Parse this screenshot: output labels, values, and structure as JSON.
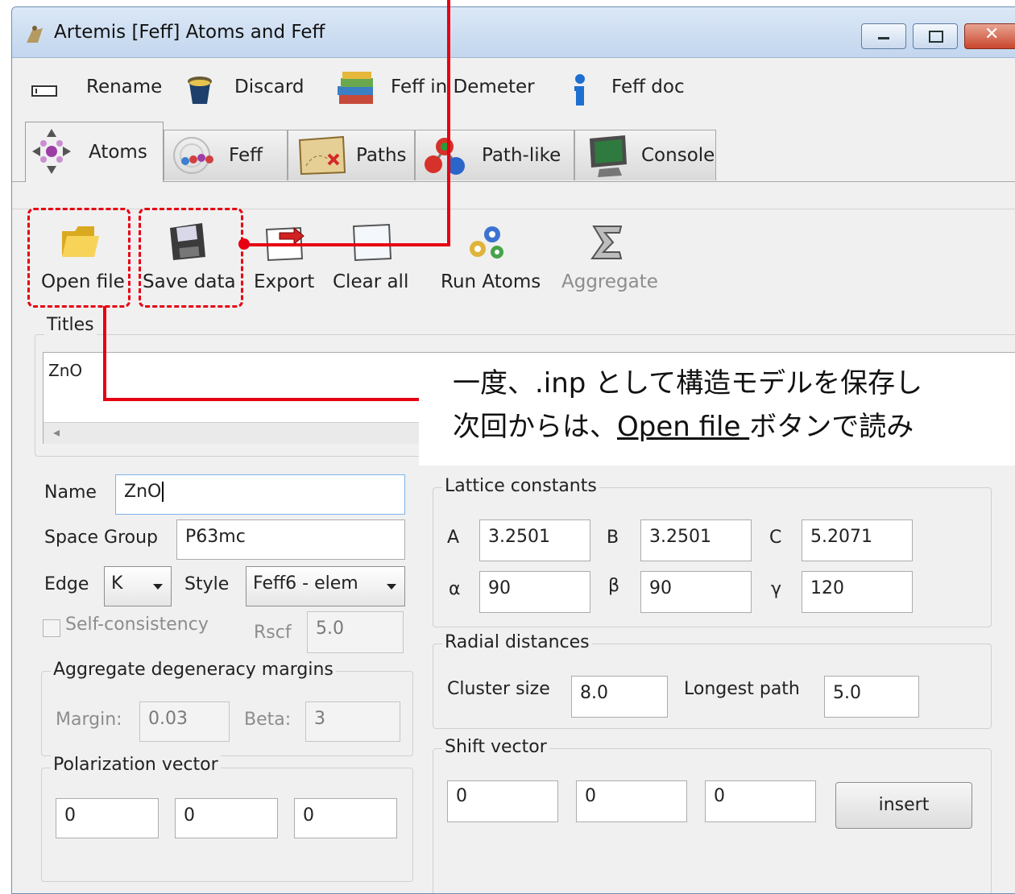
{
  "window": {
    "title": "Artemis [Feff] Atoms and Feff"
  },
  "menu": {
    "items": [
      {
        "label": "Rename",
        "icon": "rename-icon"
      },
      {
        "label": "Discard",
        "icon": "trash-icon"
      },
      {
        "label": "Feff in Demeter",
        "icon": "books-icon"
      },
      {
        "label": "Feff doc",
        "icon": "info-icon"
      }
    ]
  },
  "tabs": [
    {
      "label": "Atoms",
      "icon": "atoms-icon",
      "active": true
    },
    {
      "label": "Feff",
      "icon": "feff-icon"
    },
    {
      "label": "Paths",
      "icon": "map-icon"
    },
    {
      "label": "Path-like",
      "icon": "molecule-icon"
    },
    {
      "label": "Console",
      "icon": "monitor-icon"
    }
  ],
  "toolbar": {
    "open": "Open file",
    "save": "Save data",
    "export": "Export",
    "clear": "Clear all",
    "run": "Run Atoms",
    "aggregate": "Aggregate"
  },
  "titles": {
    "group": "Titles",
    "text": "ZnO"
  },
  "form": {
    "name_label": "Name",
    "name_value": "ZnO",
    "space_group_label": "Space Group",
    "space_group_value": "P63mc",
    "edge_label": "Edge",
    "edge_value": "K",
    "style_label": "Style",
    "style_value": "Feff6 - elem",
    "self_consistency": "Self-consistency",
    "rscf_label": "Rscf",
    "rscf_value": "5.0"
  },
  "aggregate": {
    "group": "Aggregate degeneracy margins",
    "margin_label": "Margin:",
    "margin_value": "0.03",
    "beta_label": "Beta:",
    "beta_value": "3"
  },
  "polarization": {
    "group": "Polarization vector",
    "values": [
      "0",
      "0",
      "0"
    ]
  },
  "lattice": {
    "group": "Lattice constants",
    "a_label": "A",
    "a": "3.2501",
    "b_label": "B",
    "b": "3.2501",
    "c_label": "C",
    "c": "5.2071",
    "alpha_label": "α",
    "alpha": "90",
    "beta_label": "β",
    "beta": "90",
    "gamma_label": "γ",
    "gamma": "120"
  },
  "radial": {
    "group": "Radial distances",
    "cluster_label": "Cluster size",
    "cluster_value": "8.0",
    "longest_label": "Longest path",
    "longest_value": "5.0"
  },
  "shift": {
    "group": "Shift vector",
    "values": [
      "0",
      "0",
      "0"
    ],
    "insert": "insert"
  },
  "annotation": {
    "line1": "一度、.inp として構造モデルを保存し",
    "line2_prefix": "次回からは、",
    "line2_link": "Open file ",
    "line2_suffix": "ボタンで読み"
  },
  "colors": {
    "annotation_red": "#e60012",
    "window_border": "#6d8fb5"
  }
}
